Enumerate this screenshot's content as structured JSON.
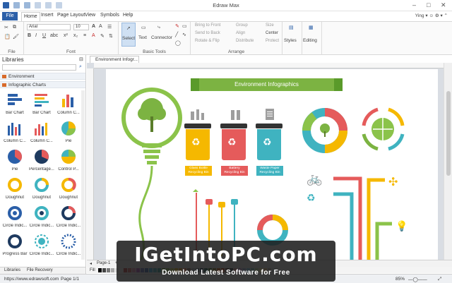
{
  "window": {
    "title": "Edraw Max",
    "user": "Ying"
  },
  "menu": {
    "file": "File",
    "tabs": [
      "Home",
      "Insert",
      "Page Layout",
      "View",
      "Symbols",
      "Help"
    ]
  },
  "ribbon": {
    "groups": {
      "file": "File",
      "font": "Font",
      "basic_tools": "Basic Tools",
      "arrange": "Arrange"
    },
    "font_name": "Arial",
    "font_size": "10",
    "tools": {
      "select": "Select",
      "text": "Text",
      "connector": "Connector"
    },
    "arrange_items": [
      "Bring to Front",
      "Send to Back",
      "Rotate & Flip",
      "Group",
      "Align",
      "Distribute",
      "Size",
      "Center",
      "Protect"
    ],
    "styles": "Styles",
    "editing": "Editing"
  },
  "libraries": {
    "header": "Libraries",
    "categories": [
      "Environment",
      "Infographic Charts"
    ],
    "shapes": [
      "Bar Chart",
      "Bar Chart",
      "Column C...",
      "Column C...",
      "Column C...",
      "Pie",
      "Pie",
      "Percentage...",
      "Control P...",
      "Doughnut",
      "Doughnut",
      "Doughnut",
      "Circle Indic...",
      "Circle Indic...",
      "Circle Indic...",
      "Progress Bar",
      "Circle Indic...",
      "Circle Indic..."
    ],
    "bottom_tabs": [
      "Libraries",
      "File Recovery"
    ]
  },
  "document": {
    "tab": "Environment Infogr...",
    "banner": "Environment Infographics",
    "bins": [
      {
        "label": "Glass Bottle Recycling Bin",
        "color": "#f5b800"
      },
      {
        "label": "Battery Recycling Bin",
        "color": "#e55b5b"
      },
      {
        "label": "Waste Paper Recycling Bin",
        "color": "#3fb3c0"
      }
    ]
  },
  "pagebar": {
    "page": "Page-1",
    "fill": "Fill"
  },
  "status": {
    "url": "https://www.edrawsoft.com",
    "page": "Page 1/1",
    "zoom": "85%"
  },
  "watermark": {
    "title": "IGetIntoPC.com",
    "tagline": "Download Latest Software for Free"
  },
  "colors": {
    "file_tab": "#2b5fa8",
    "banner": "#7cb342",
    "accent_green": "#8bc34a"
  }
}
